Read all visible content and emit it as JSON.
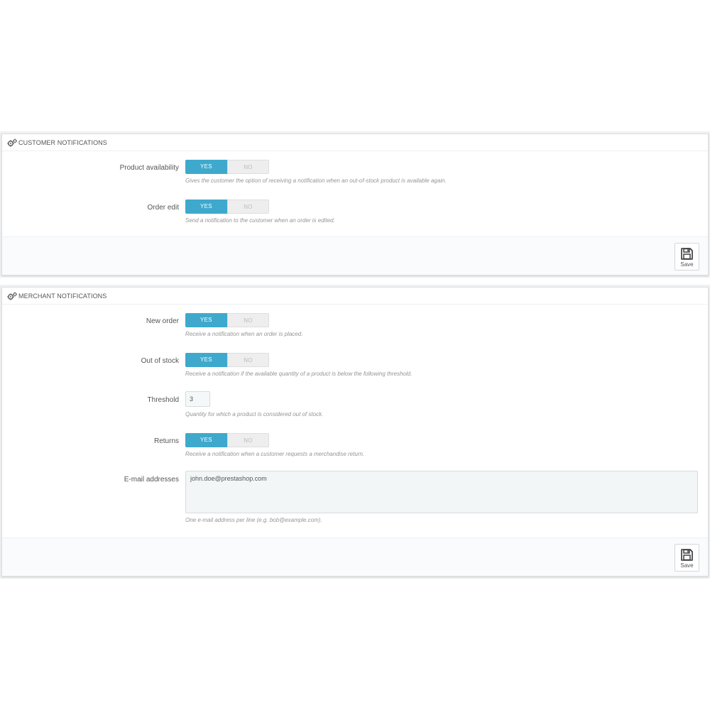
{
  "customer_panel": {
    "heading": "CUSTOMER NOTIFICATIONS",
    "fields": [
      {
        "label": "Product availability",
        "yes_label": "YES",
        "no_label": "NO",
        "selected": "YES",
        "help": "Gives the customer the option of receiving a notification when an out-of-stock product is available again."
      },
      {
        "label": "Order edit",
        "yes_label": "YES",
        "no_label": "NO",
        "selected": "YES",
        "help": "Send a notification to the customer when an order is edited."
      }
    ],
    "save_label": "Save"
  },
  "merchant_panel": {
    "heading": "MERCHANT NOTIFICATIONS",
    "fields": [
      {
        "label": "New order",
        "yes_label": "YES",
        "no_label": "NO",
        "selected": "YES",
        "help": "Receive a notification when an order is placed."
      },
      {
        "label": "Out of stock",
        "yes_label": "YES",
        "no_label": "NO",
        "selected": "YES",
        "help": "Receive a notification if the available quantity of a product is below the following threshold."
      },
      {
        "label": "Threshold",
        "value": "3",
        "help": "Quantity for which a product is considered out of stock."
      },
      {
        "label": "Returns",
        "yes_label": "YES",
        "no_label": "NO",
        "selected": "YES",
        "help": "Receive a notification when a customer requests a merchandise return."
      },
      {
        "label": "E-mail addresses",
        "value": "john.doe@prestashop.com",
        "help": "One e-mail address per line (e.g. bob@example.com)."
      }
    ],
    "save_label": "Save"
  },
  "colors": {
    "switch_active": "#3ea9cd",
    "switch_inactive": "#eeeeee",
    "help_text": "#959595",
    "panel_border": "#dcdfe2"
  },
  "icons": {
    "panel_heading": "cogs-icon",
    "save": "floppy-disk-icon"
  }
}
